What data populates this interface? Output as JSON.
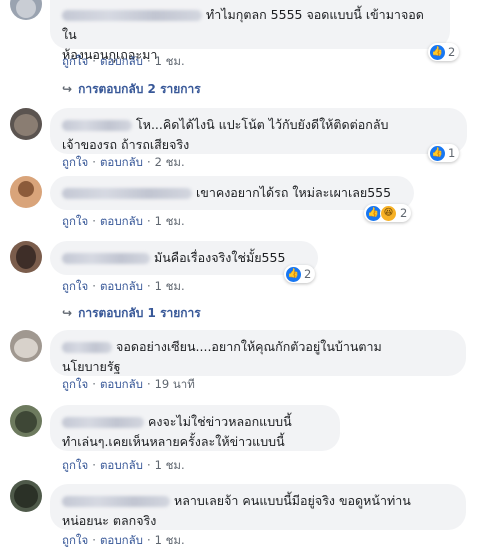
{
  "comments": [
    {
      "text": "ทำไมกุตลก 5555 จอดแบบนี้ เข้ามาจอดใน\nห้องนอนกูเถอะมา",
      "like": "ถูกใจ",
      "reply": "ตอบกลับ",
      "time": "1 ชม.",
      "reactions": "2",
      "view_replies": "การตอบกลับ 2 รายการ"
    },
    {
      "text": "โห...คิดได้ไงนิ แปะโน้ต ไว้กับยังดีให้ติดต่อกลับ\nเจ้าของรถ ถ้ารถเสียจริง",
      "like": "ถูกใจ",
      "reply": "ตอบกลับ",
      "time": "2 ชม.",
      "reactions": "1"
    },
    {
      "text": "เขาคงอยากได้รถ ใหม่ละเผาเลย555",
      "like": "ถูกใจ",
      "reply": "ตอบกลับ",
      "time": "1 ชม.",
      "reactions": "2"
    },
    {
      "text": "มันคือเรื่องจริงใช่มั้ย555",
      "like": "ถูกใจ",
      "reply": "ตอบกลับ",
      "time": "1 ชม.",
      "reactions": "2",
      "view_replies": "การตอบกลับ 1 รายการ"
    },
    {
      "text": "จอดอย่างเซียน....อยากให้คุณกักตัวอยู่ในบ้านตาม\nนโยบายรัฐ",
      "like": "ถูกใจ",
      "reply": "ตอบกลับ",
      "time": "19 นาที"
    },
    {
      "text": "คงจะไม่ใช่ข่าวหลอกแบบนี้\nทำเล่นๆ.เคยเห็นหลายครั้งละให้ข่าวแบบนี้",
      "like": "ถูกใจ",
      "reply": "ตอบกลับ",
      "time": "1 ชม."
    },
    {
      "text": "หลาบเลยจ้า คนแบบนี้มีอยู่จริง ขอดูหน้าท่าน\nหน่อยนะ ตลกจริง",
      "like": "ถูกใจ",
      "reply": "ตอบกลับ",
      "time": "1 ชม."
    }
  ],
  "icons": {
    "like": "like-icon",
    "haha": "haha-icon",
    "reply_arrow": "reply-arrow-icon"
  }
}
